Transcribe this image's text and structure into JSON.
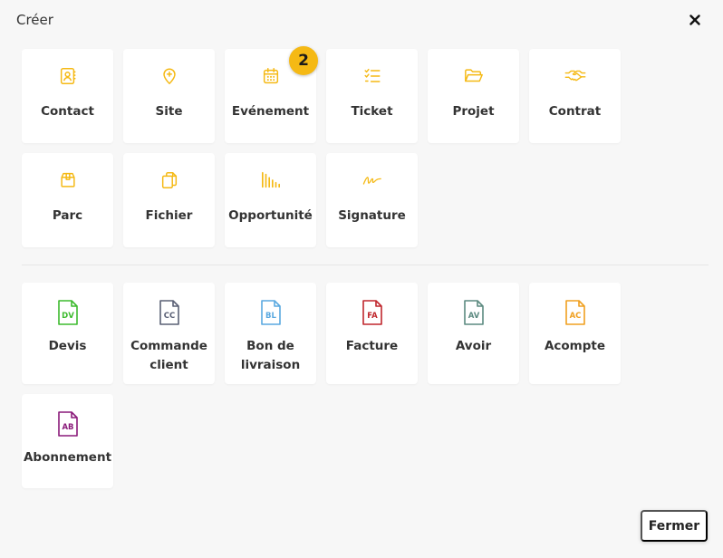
{
  "dialog": {
    "title": "Créer",
    "close_label": "Fermer",
    "badge": "2"
  },
  "colors": {
    "accent": "#f5b914",
    "devis": "#3dbb2e",
    "commande": "#5a6075",
    "bon_livraison": "#5aa9e0",
    "facture": "#c0272d",
    "avoir": "#5c8a80",
    "acompte": "#f0a020",
    "abonnement": "#8a1a7a"
  },
  "create_items": [
    {
      "label": "Contact",
      "icon": "contact-card-icon"
    },
    {
      "label": "Site",
      "icon": "map-pin-plus-icon"
    },
    {
      "label": "Evénement",
      "icon": "calendar-icon"
    },
    {
      "label": "Ticket",
      "icon": "checklist-icon"
    },
    {
      "label": "Projet",
      "icon": "folder-open-icon"
    },
    {
      "label": "Contrat",
      "icon": "handshake-icon"
    },
    {
      "label": "Parc",
      "icon": "box-icon"
    },
    {
      "label": "Fichier",
      "icon": "copy-files-icon"
    },
    {
      "label": "Opportunité",
      "icon": "bar-chart-icon"
    },
    {
      "label": "Signature",
      "icon": "signature-icon"
    }
  ],
  "documents": [
    {
      "label": "Devis",
      "abbr": "DV",
      "icon": "document-dv-icon"
    },
    {
      "label": "Commande client",
      "abbr": "CC",
      "icon": "document-cc-icon"
    },
    {
      "label": "Bon de livraison",
      "abbr": "BL",
      "icon": "document-bl-icon"
    },
    {
      "label": "Facture",
      "abbr": "FA",
      "icon": "document-fa-icon"
    },
    {
      "label": "Avoir",
      "abbr": "AV",
      "icon": "document-av-icon"
    },
    {
      "label": "Acompte",
      "abbr": "AC",
      "icon": "document-ac-icon"
    },
    {
      "label": "Abonnement",
      "abbr": "AB",
      "icon": "document-ab-icon"
    }
  ]
}
